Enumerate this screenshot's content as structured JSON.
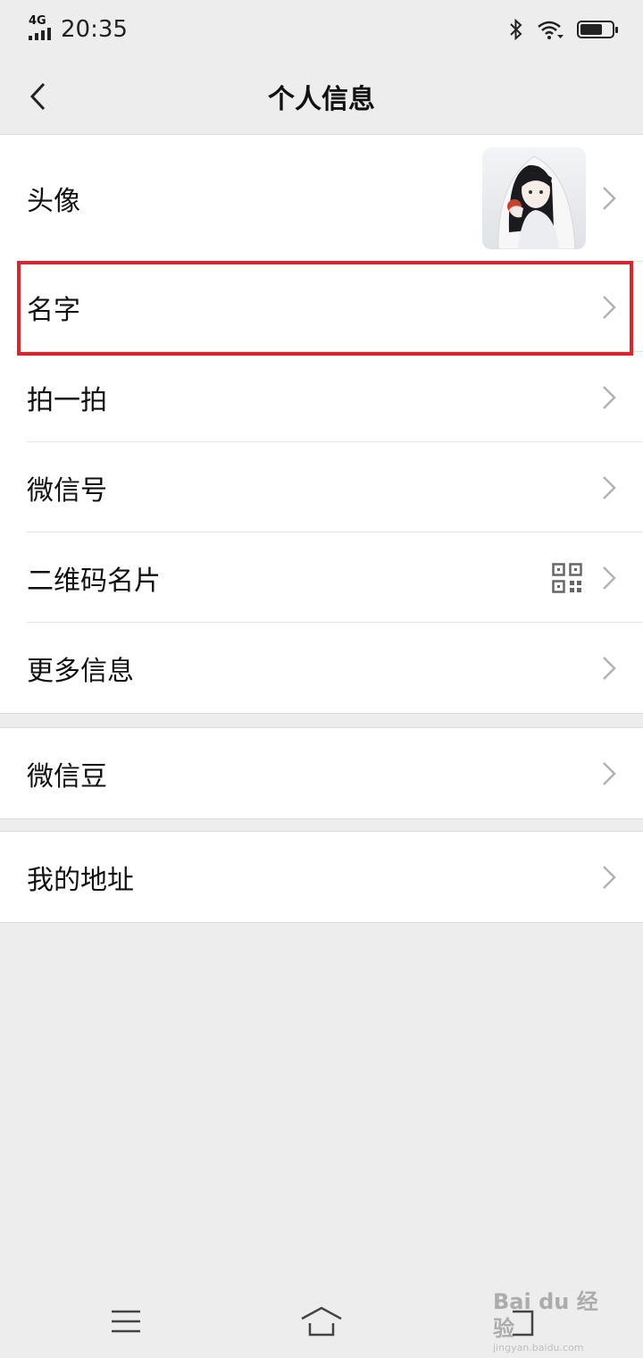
{
  "status_bar": {
    "network": "4G",
    "time": "20:35",
    "battery_level": 0.7
  },
  "header": {
    "title": "个人信息"
  },
  "groups": [
    {
      "items": [
        {
          "label": "头像"
        },
        {
          "label": "名字"
        },
        {
          "label": "拍一拍"
        },
        {
          "label": "微信号"
        },
        {
          "label": "二维码名片"
        },
        {
          "label": "更多信息"
        }
      ]
    },
    {
      "items": [
        {
          "label": "微信豆"
        }
      ]
    },
    {
      "items": [
        {
          "label": "我的地址"
        }
      ]
    }
  ],
  "watermark": {
    "text": "Bai du 经验",
    "url": "jingyan.baidu.com"
  },
  "colors": {
    "background": "#ededed",
    "highlight": "#d9252e",
    "chevron": "#b2b2b2"
  }
}
